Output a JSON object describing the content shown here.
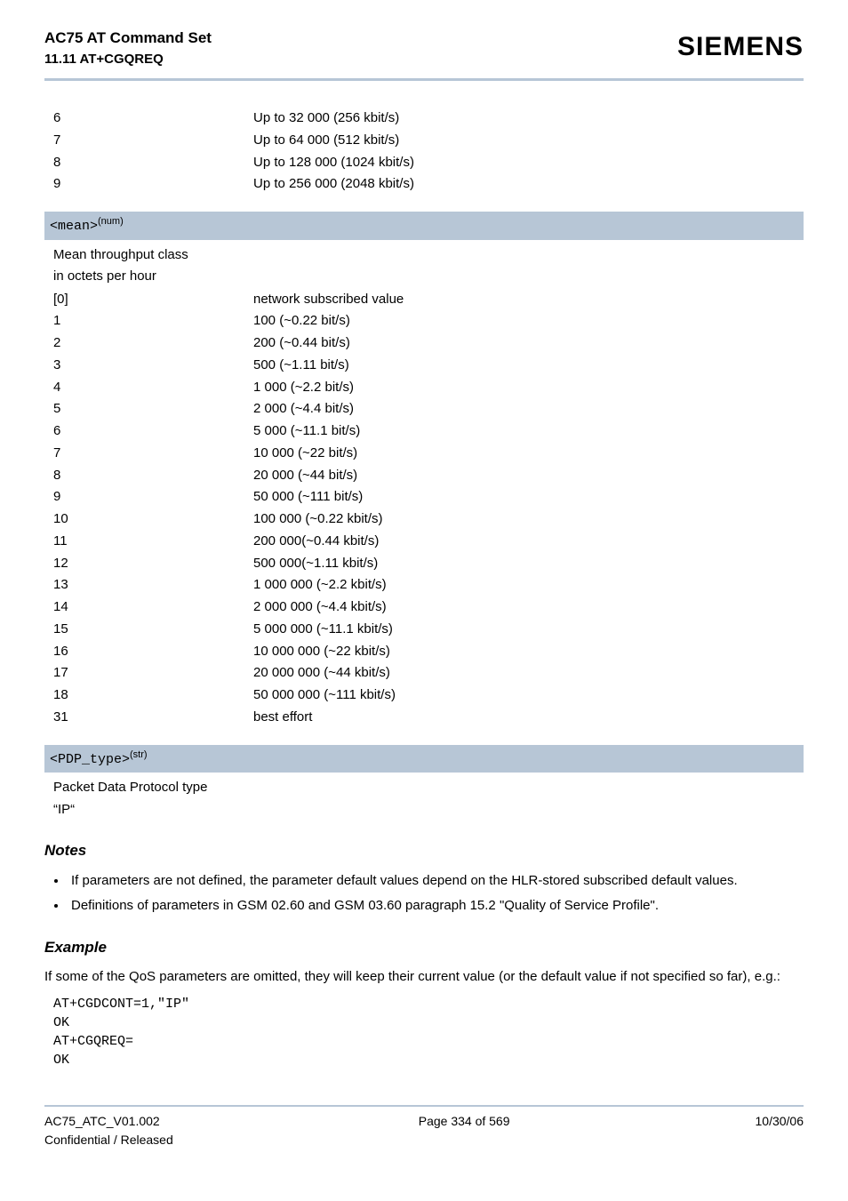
{
  "header": {
    "title": "AC75 AT Command Set",
    "subtitle": "11.11 AT+CGQREQ",
    "brand": "SIEMENS"
  },
  "top_rows": [
    {
      "k": "6",
      "v": "Up to 32 000 (256 kbit/s)"
    },
    {
      "k": "7",
      "v": "Up to 64 000 (512 kbit/s)"
    },
    {
      "k": "8",
      "v": "Up to 128 000 (1024 kbit/s)"
    },
    {
      "k": "9",
      "v": "Up to 256 000 (2048 kbit/s)"
    }
  ],
  "mean": {
    "label_code": "<mean>",
    "label_sup": "(num)",
    "desc1": "Mean throughput class",
    "desc2": "in octets per hour",
    "rows": [
      {
        "k": "[0]",
        "v": "network subscribed value"
      },
      {
        "k": "1",
        "v": "100 (~0.22 bit/s)"
      },
      {
        "k": "2",
        "v": "200 (~0.44 bit/s)"
      },
      {
        "k": "3",
        "v": "500 (~1.11 bit/s)"
      },
      {
        "k": "4",
        "v": "1 000 (~2.2 bit/s)"
      },
      {
        "k": "5",
        "v": "2 000 (~4.4 bit/s)"
      },
      {
        "k": "6",
        "v": "5 000 (~11.1 bit/s)"
      },
      {
        "k": "7",
        "v": "10 000 (~22 bit/s)"
      },
      {
        "k": "8",
        "v": "20 000 (~44 bit/s)"
      },
      {
        "k": "9",
        "v": "50 000 (~111 bit/s)"
      },
      {
        "k": "10",
        "v": "100 000 (~0.22 kbit/s)"
      },
      {
        "k": "11",
        "v": "200 000(~0.44 kbit/s)"
      },
      {
        "k": "12",
        "v": "500 000(~1.11 kbit/s)"
      },
      {
        "k": "13",
        "v": "1 000 000 (~2.2 kbit/s)"
      },
      {
        "k": "14",
        "v": "2 000 000 (~4.4 kbit/s)"
      },
      {
        "k": "15",
        "v": "5 000 000 (~11.1 kbit/s)"
      },
      {
        "k": "16",
        "v": "10 000 000 (~22 kbit/s)"
      },
      {
        "k": "17",
        "v": "20 000 000 (~44 kbit/s)"
      },
      {
        "k": "18",
        "v": "50 000 000 (~111 kbit/s)"
      },
      {
        "k": "31",
        "v": "best effort"
      }
    ]
  },
  "pdp": {
    "label_code": "<PDP_type>",
    "label_sup": "(str)",
    "desc1": "Packet Data Protocol type",
    "desc2": "“IP“"
  },
  "notes": {
    "heading": "Notes",
    "items": [
      "If parameters are not defined, the parameter default values depend on the HLR-stored subscribed default values.",
      "Definitions of parameters in GSM 02.60 and GSM 03.60 paragraph 15.2 \"Quality of Service Profile\"."
    ]
  },
  "example": {
    "heading": "Example",
    "intro": "If some of the QoS parameters are omitted, they will keep their current value (or the default value if not specified so far), e.g.:",
    "code": "AT+CGDCONT=1,\"IP\"\nOK\nAT+CGQREQ=\nOK"
  },
  "footer": {
    "left1": "AC75_ATC_V01.002",
    "left2": "Confidential / Released",
    "center": "Page 334 of 569",
    "right": "10/30/06"
  }
}
